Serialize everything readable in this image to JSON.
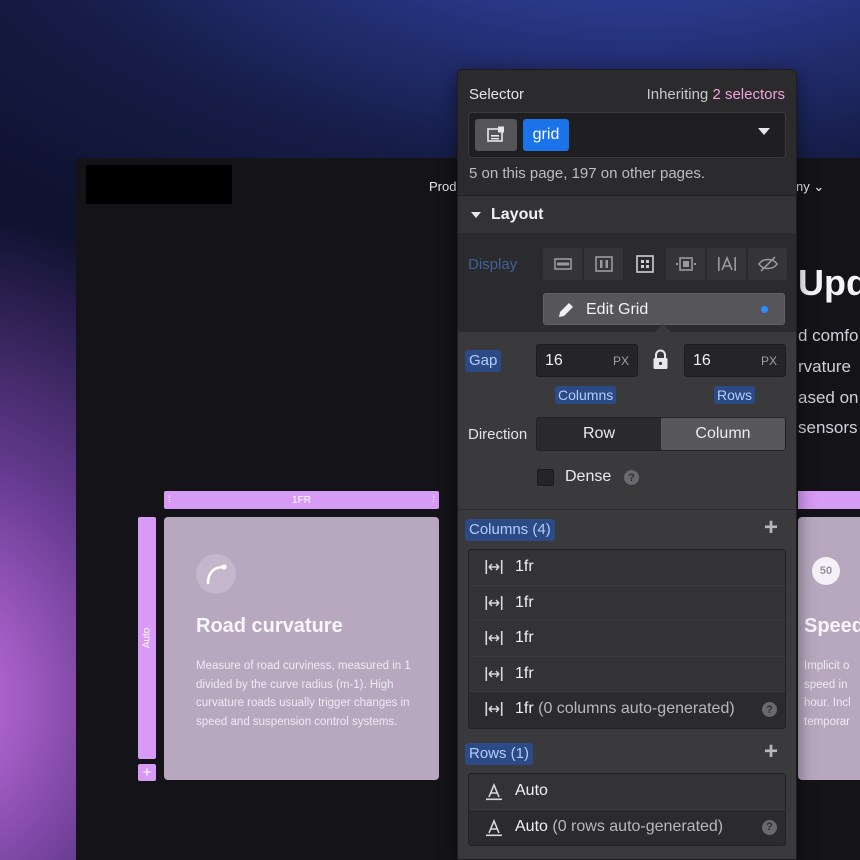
{
  "page": {
    "nav_left": "Prod",
    "nav_right": "ny ⌄",
    "hero_title": "Upda",
    "hero_lines": [
      "d comfo",
      "rvature",
      "ased on",
      "sensors"
    ],
    "column_track_label": "1FR",
    "row_track_label": "Auto",
    "add_row_label": "+"
  },
  "cards": [
    {
      "title": "Road curvature",
      "body": "Measure of road curviness, measured in 1 divided by the curve radius (m-1). High curvature roads usually trigger changes in speed and suspension control systems.",
      "icon": "curve-icon"
    },
    {
      "badge": "50",
      "title": "Speed",
      "body_lines": [
        "Implicit o",
        "speed in",
        "hour. Incl",
        "temporar"
      ],
      "icon": "speed-badge"
    }
  ],
  "panel": {
    "selector_label": "Selector",
    "inheriting_prefix": "Inheriting",
    "inheriting_count": "2 selectors",
    "selector_chip": "grid",
    "selector_count_text": "5 on this page, 197 on other pages.",
    "layout_section": "Layout",
    "display_label": "Display",
    "display_options": [
      "block-icon",
      "flex-icon",
      "grid-icon",
      "inline-block-icon",
      "inline-text-icon",
      "none-icon"
    ],
    "display_active_index": 2,
    "edit_grid_label": "Edit Grid",
    "gap": {
      "label": "Gap",
      "columns_value": "16",
      "rows_value": "16",
      "unit": "PX",
      "columns_label": "Columns",
      "rows_label": "Rows"
    },
    "direction": {
      "label": "Direction",
      "options": [
        "Row",
        "Column"
      ],
      "selected": "Column"
    },
    "dense_label": "Dense",
    "columns_header": "Columns (4)",
    "columns": [
      {
        "value": "1fr",
        "note": ""
      },
      {
        "value": "1fr",
        "note": ""
      },
      {
        "value": "1fr",
        "note": ""
      },
      {
        "value": "1fr",
        "note": ""
      },
      {
        "value": "1fr",
        "note": "(0 columns auto-generated)"
      }
    ],
    "rows_header": "Rows (1)",
    "rows": [
      {
        "value": "Auto",
        "note": ""
      },
      {
        "value": "Auto",
        "note": "(0 rows auto-generated)"
      }
    ]
  },
  "colors": {
    "accent_blue": "#1a73e8",
    "grid_overlay": "#d79bf5",
    "inherit_pink": "#f1a3d8"
  }
}
